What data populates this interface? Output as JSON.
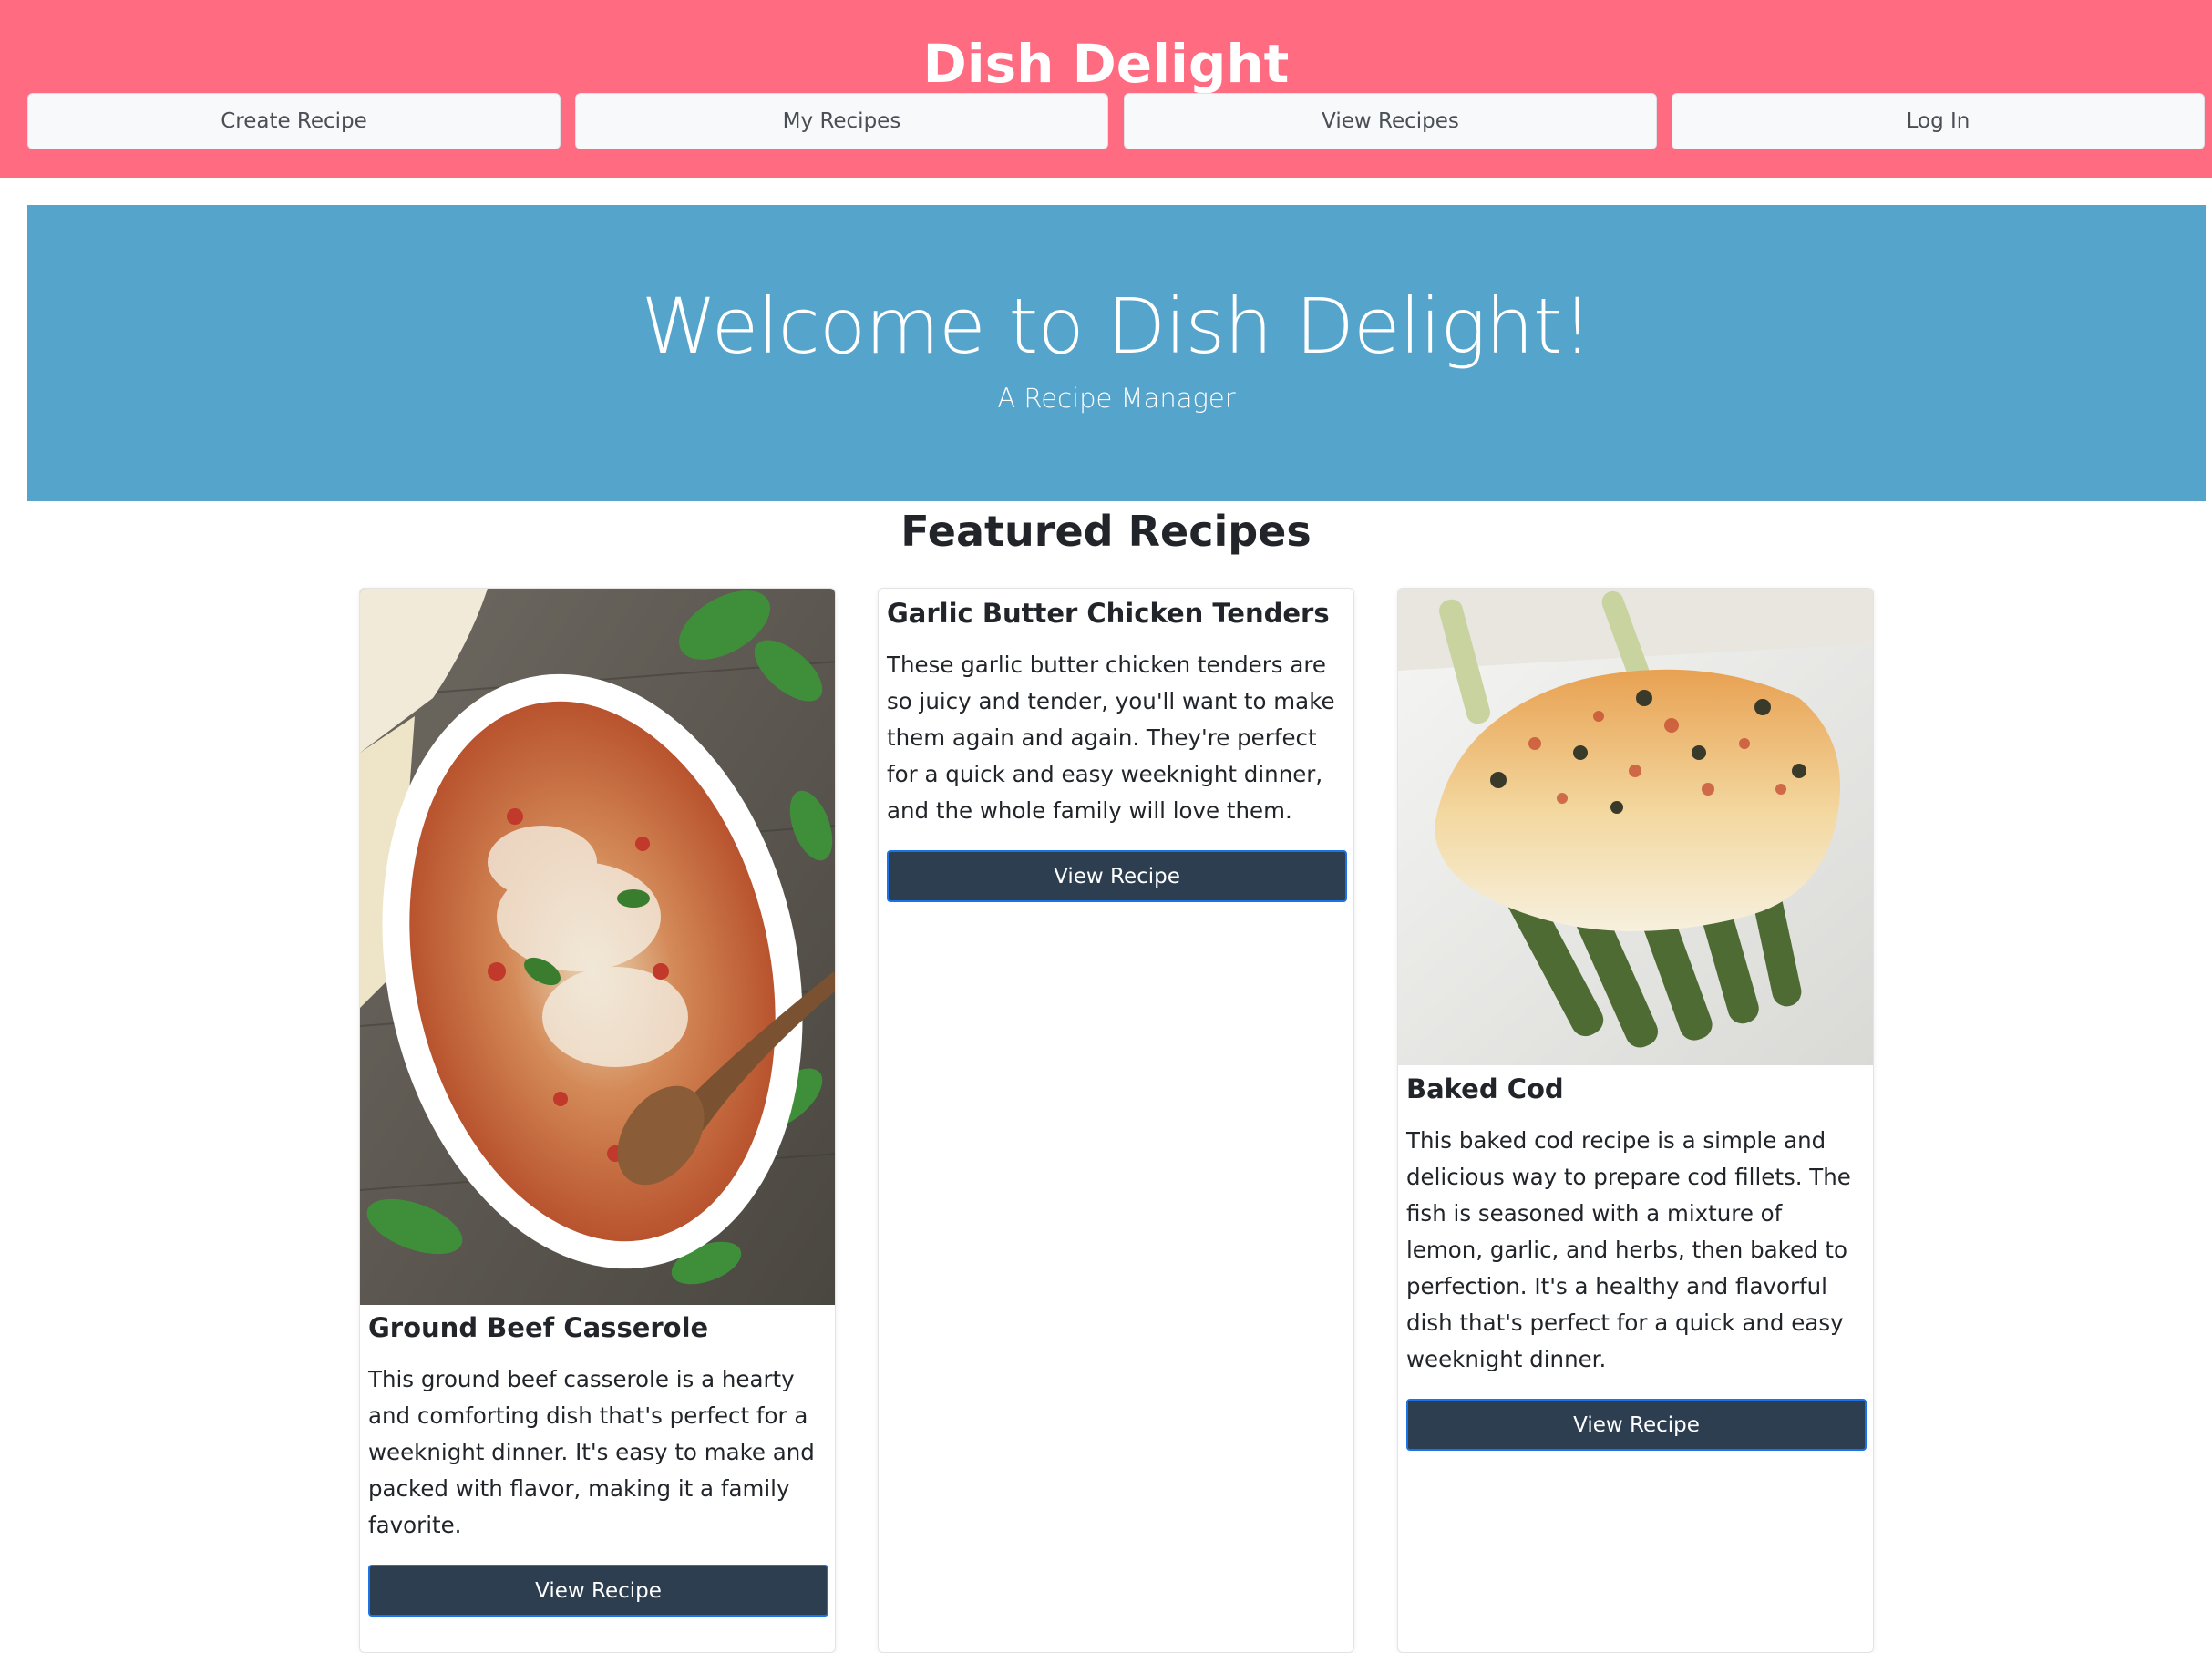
{
  "header": {
    "title": "Dish Delight",
    "nav": [
      {
        "label": "Create Recipe"
      },
      {
        "label": "My Recipes"
      },
      {
        "label": "View Recipes"
      },
      {
        "label": "Log In"
      }
    ]
  },
  "hero": {
    "title": "Welcome to Dish Delight!",
    "subtitle": "A Recipe Manager"
  },
  "featured": {
    "heading": "Featured Recipes",
    "cards": [
      {
        "title": "Ground Beef Casserole",
        "description": "This ground beef casserole is a hearty and comforting dish that's perfect for a weeknight dinner. It's easy to make and packed with flavor, making it a family favorite.",
        "button": "View Recipe",
        "image": "casserole-photo"
      },
      {
        "title": "Garlic Butter Chicken Tenders",
        "description": "These garlic butter chicken tenders are so juicy and tender, you'll want to make them again and again. They're perfect for a quick and easy weeknight dinner, and the whole family will love them.",
        "button": "View Recipe"
      },
      {
        "title": "Baked Cod",
        "description": "This baked cod recipe is a simple and delicious way to prepare cod fillets. The fish is seasoned with a mixture of lemon, garlic, and herbs, then baked to perfection. It's a healthy and flavorful dish that's perfect for a quick and easy weeknight dinner.",
        "button": "View Recipe",
        "image": "baked-cod-photo"
      }
    ]
  },
  "colors": {
    "header_bg": "#ff6b80",
    "hero_bg": "#55a4cc",
    "button_bg": "#2c3e50"
  }
}
